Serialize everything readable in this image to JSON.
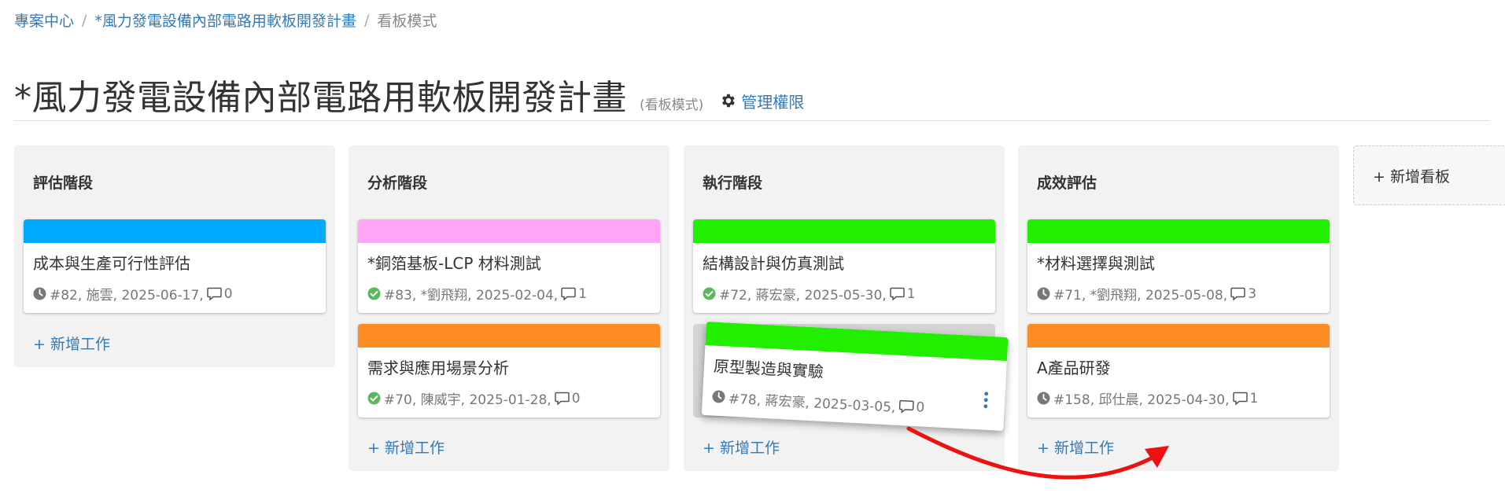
{
  "breadcrumb": {
    "items": [
      "專案中心",
      "*風力發電設備內部電路用軟板開發計畫"
    ],
    "separator": "/",
    "current": "看板模式"
  },
  "header": {
    "title": "*風力發電設備內部電路用軟板開發計畫",
    "subtitle": "(看板模式)",
    "permission_link": "管理權限",
    "permission_icon": "gear-icon"
  },
  "add_board_label": "+ 新增看板",
  "lanes": [
    {
      "title": "評估階段",
      "add_task_label": "+ 新增工作",
      "cards": [
        {
          "title": "成本與生產可行性評估",
          "meta": "#82, 施雲, 2025-06-17,",
          "comments": "0",
          "status_icon": "clock-icon",
          "color": "#00aaff"
        }
      ]
    },
    {
      "title": "分析階段",
      "add_task_label": "+ 新增工作",
      "cards": [
        {
          "title": "*銅箔基板-LCP 材料測試",
          "meta": "#83, *劉飛翔, 2025-02-04,",
          "comments": "1",
          "status_icon": "check-circle-icon",
          "color": "#ffa5f5"
        },
        {
          "title": "需求與應用場景分析",
          "meta": "#70, 陳威宇, 2025-01-28,",
          "comments": "0",
          "status_icon": "check-circle-icon",
          "color": "#ff8c22"
        }
      ]
    },
    {
      "title": "執行階段",
      "add_task_label": "+ 新增工作",
      "cards": [
        {
          "title": "結構設計與仿真測試",
          "meta": "#72, 蔣宏豪, 2025-05-30,",
          "comments": "1",
          "status_icon": "check-circle-icon",
          "color": "#22ee00"
        }
      ]
    },
    {
      "title": "成效評估",
      "add_task_label": "+ 新增工作",
      "cards": [
        {
          "title": "*材料選擇與測試",
          "meta": "#71, *劉飛翔, 2025-05-08,",
          "comments": "3",
          "status_icon": "clock-icon",
          "color": "#22ee00"
        },
        {
          "title": "A產品研發",
          "meta": "#158, 邱仕晨, 2025-04-30,",
          "comments": "1",
          "status_icon": "clock-icon",
          "color": "#ff8c22"
        }
      ]
    }
  ],
  "dragging_card": {
    "title": "原型製造與實驗",
    "meta": "#78, 蔣宏豪, 2025-03-05,",
    "comments": "0",
    "status_icon": "clock-icon",
    "color": "#22ee00"
  },
  "colors": {
    "link": "#337ab7",
    "arrow": "#ee1111",
    "check": "#5cb85c",
    "clock": "#777777",
    "kebab": "#337ab7"
  }
}
